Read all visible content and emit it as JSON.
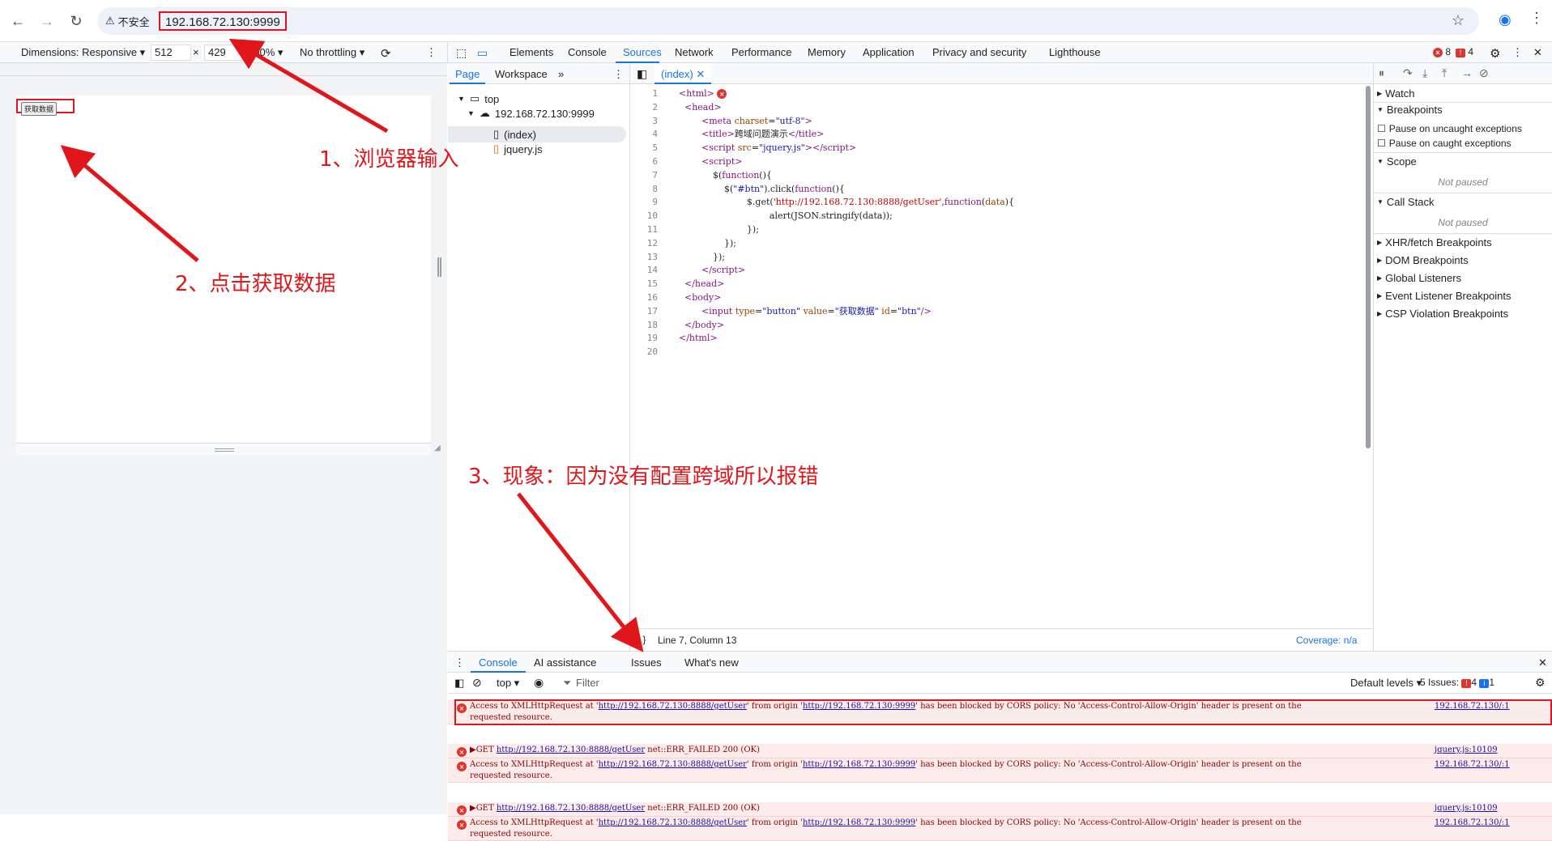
{
  "browser": {
    "security_label": "不安全",
    "url": "192.168.72.130:9999"
  },
  "device_toolbar": {
    "dimensions_label": "Dimensions: Responsive ▾",
    "width": "512",
    "times": "×",
    "height": "429",
    "zoom": "100% ▾",
    "throttling": "No throttling ▾"
  },
  "page": {
    "button_value": "获取数据"
  },
  "devtools": {
    "tabs": [
      "Elements",
      "Console",
      "Sources",
      "Network",
      "Performance",
      "Memory",
      "Application",
      "Privacy and security",
      "Lighthouse"
    ],
    "active_tab": "Sources",
    "error_count": "8",
    "warning_count": "4"
  },
  "navigator": {
    "tabs": [
      "Page",
      "Workspace"
    ],
    "tree": {
      "top": "top",
      "origin": "192.168.72.130:9999",
      "files": [
        "(index)",
        "jquery.js"
      ]
    }
  },
  "editor": {
    "tab_label": "(index)",
    "line_numbers": [
      "1",
      "2",
      "3",
      "4",
      "5",
      "6",
      "7",
      "8",
      "9",
      "10",
      "11",
      "12",
      "13",
      "14",
      "15",
      "16",
      "17",
      "18",
      "19",
      "20"
    ],
    "status_position": "Line 7, Column 13",
    "coverage": "Coverage: n/a"
  },
  "debugger": {
    "sections": {
      "watch": "Watch",
      "breakpoints": "Breakpoints",
      "pause_uncaught": "Pause on uncaught exceptions",
      "pause_caught": "Pause on caught exceptions",
      "scope": "Scope",
      "not_paused": "Not paused",
      "call_stack": "Call Stack",
      "xhr": "XHR/fetch Breakpoints",
      "dom": "DOM Breakpoints",
      "global": "Global Listeners",
      "event": "Event Listener Breakpoints",
      "csp": "CSP Violation Breakpoints"
    }
  },
  "drawer": {
    "tabs": [
      "Console",
      "AI assistance",
      "Issues",
      "What's new"
    ],
    "context": "top ▾",
    "filter_placeholder": "Filter",
    "levels": "Default levels ▾",
    "issues_label": "5 Issues:",
    "issues_err": "4",
    "issues_info": "1"
  },
  "console_messages": [
    {
      "type": "cors",
      "a": "Access to XMLHttpRequest at '",
      "url": "http://192.168.72.130:8888/getUser",
      "b": "' from origin '",
      "origin": "http://192.168.72.130:9999",
      "c": "' has been blocked by CORS policy: No 'Access-Control-Allow-Origin' header is present on the",
      "d": "requested resource.",
      "src": "192.168.72.130/:1"
    },
    {
      "type": "get",
      "a": "▶GET ",
      "url": "http://192.168.72.130:8888/getUser",
      "b": " net::ERR_FAILED 200 (OK)",
      "src": "jquery.js:10109"
    },
    {
      "type": "cors",
      "a": "Access to XMLHttpRequest at '",
      "url": "http://192.168.72.130:8888/getUser",
      "b": "' from origin '",
      "origin": "http://192.168.72.130:9999",
      "c": "' has been blocked by CORS policy: No 'Access-Control-Allow-Origin' header is present on the",
      "d": "requested resource.",
      "src": "192.168.72.130/:1"
    },
    {
      "type": "get",
      "a": "▶GET ",
      "url": "http://192.168.72.130:8888/getUser",
      "b": " net::ERR_FAILED 200 (OK)",
      "src": "jquery.js:10109"
    },
    {
      "type": "cors",
      "a": "Access to XMLHttpRequest at '",
      "url": "http://192.168.72.130:8888/getUser",
      "b": "' from origin '",
      "origin": "http://192.168.72.130:9999",
      "c": "' has been blocked by CORS policy: No 'Access-Control-Allow-Origin' header is present on the",
      "d": "requested resource.",
      "src": "192.168.72.130/:1"
    }
  ],
  "annotations": {
    "step1": "1、浏览器输入",
    "step2": "2、点击获取数据",
    "step3": "3、现象：因为没有配置跨域所以报错"
  }
}
